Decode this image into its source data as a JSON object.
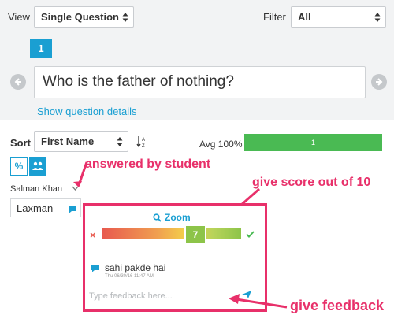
{
  "view": {
    "label": "View",
    "value": "Single Question"
  },
  "filter": {
    "label": "Filter",
    "value": "All"
  },
  "question": {
    "number": "1",
    "text": "Who is the father of nothing?",
    "details_link": "Show question details"
  },
  "sort": {
    "label": "Sort",
    "value": "First Name"
  },
  "average": {
    "label": "Avg 100%",
    "bar_value": "1",
    "bar_color": "#4aba53"
  },
  "toggles": [
    {
      "label": "%",
      "icon": "percent-icon"
    },
    {
      "label": "",
      "icon": "group-icon"
    }
  ],
  "students": [
    {
      "name": "Salman Khan",
      "icon": "chevron-down-icon"
    },
    {
      "name": "Laxman",
      "icon": "chat-icon"
    }
  ],
  "grading": {
    "zoom_label": "Zoom",
    "score": "7",
    "score_fraction": 0.7,
    "comment": "sahi pakde hai",
    "comment_time": "Thu 06/30/16 11:47 AM",
    "feedback_placeholder": "Type feedback here...",
    "accent": "#1a9fd2"
  },
  "annotations": {
    "answered": "answered by student",
    "score": "give score out of 10",
    "feedback": "give feedback",
    "color": "#e8306a"
  }
}
